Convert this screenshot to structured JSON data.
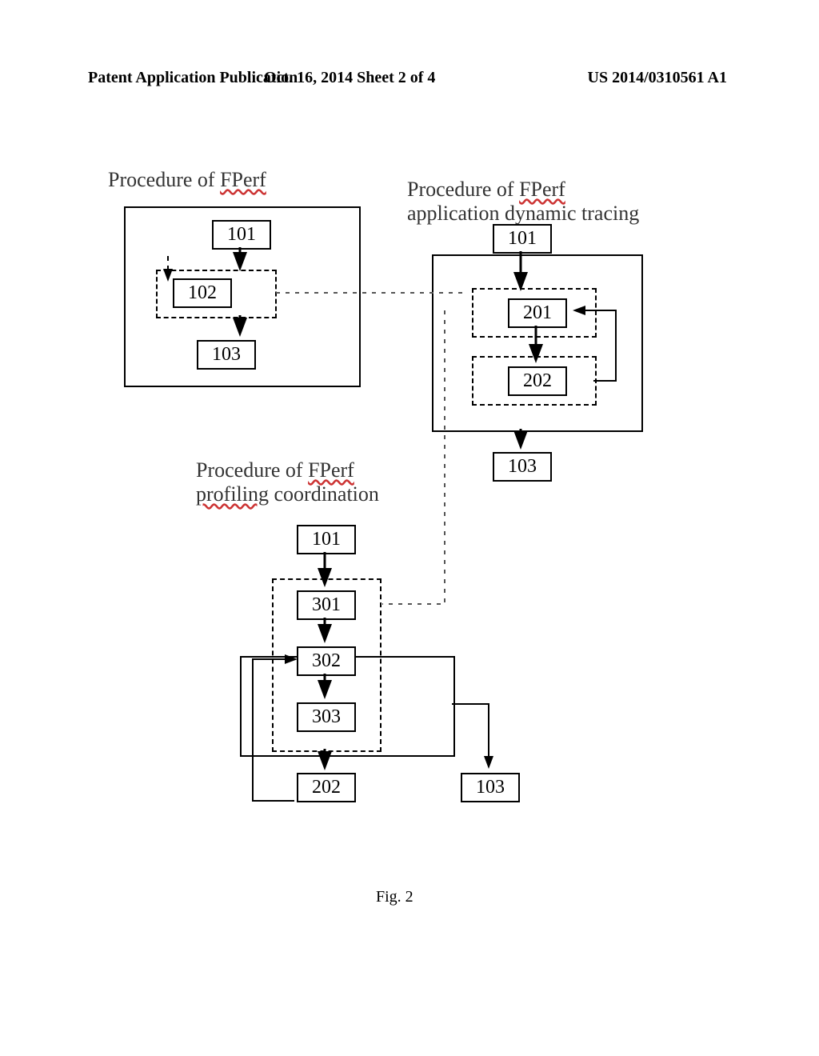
{
  "header": {
    "left": "Patent Application Publication",
    "mid": "Oct. 16, 2014  Sheet 2 of 4",
    "right": "US 2014/0310561 A1"
  },
  "titles": {
    "t1_prefix": "Procedure of ",
    "t1_mark": "FPerf",
    "t2_prefix": "Procedure of ",
    "t2_mark": "FPerf",
    "t2_line2": "application dynamic tracing",
    "t3_prefix": "Procedure of ",
    "t3_mark1": "FPerf",
    "t3_line2_mark": "profiling",
    "t3_line2_rest": " coordination"
  },
  "boxes": {
    "a101": "101",
    "a102": "102",
    "a103": "103",
    "b101": "101",
    "b201": "201",
    "b202": "202",
    "b103": "103",
    "c101": "101",
    "c301": "301",
    "c302": "302",
    "c303": "303",
    "c202": "202",
    "c103": "103"
  },
  "figure_caption": "Fig. 2"
}
